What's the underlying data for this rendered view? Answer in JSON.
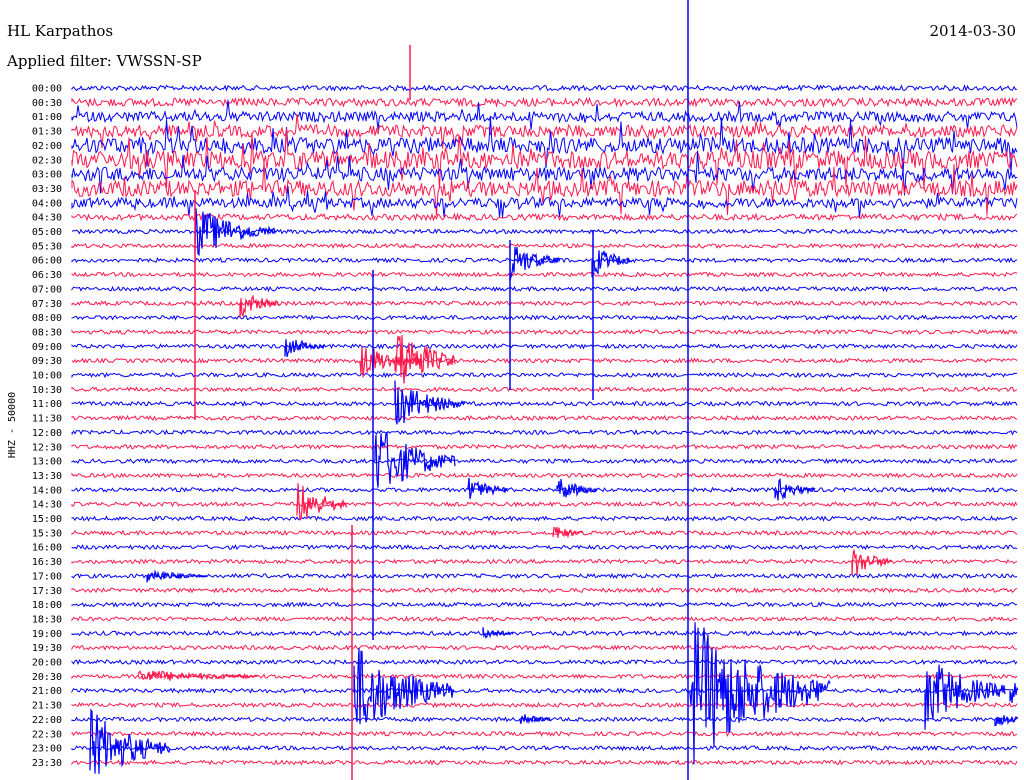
{
  "header": {
    "station": "HL Karpathos",
    "date": "2014-03-30",
    "filter": "Applied filter: VWSSN-SP"
  },
  "chart_data": {
    "type": "line",
    "title": "HL Karpathos",
    "ylabel": "HHZ - 50000",
    "colors": [
      "#0000ff",
      "#ff1a4d"
    ],
    "rows": [
      "00:00",
      "00:30",
      "01:00",
      "01:30",
      "02:00",
      "02:30",
      "03:00",
      "03:30",
      "04:00",
      "04:30",
      "05:00",
      "05:30",
      "06:00",
      "06:30",
      "07:00",
      "07:30",
      "08:00",
      "08:30",
      "09:00",
      "09:30",
      "10:00",
      "10:30",
      "11:00",
      "11:30",
      "12:00",
      "12:30",
      "13:00",
      "13:30",
      "14:00",
      "14:30",
      "15:00",
      "15:30",
      "16:00",
      "16:30",
      "17:00",
      "17:30",
      "18:00",
      "18:30",
      "19:00",
      "19:30",
      "20:00",
      "20:30",
      "21:00",
      "21:30",
      "22:00",
      "22:30",
      "23:00",
      "23:30"
    ],
    "noise_level": [
      2.5,
      4,
      5,
      6,
      8,
      9,
      7,
      8,
      5,
      3,
      2,
      2,
      2,
      2,
      2,
      2,
      2,
      2,
      2,
      2,
      2,
      2,
      2,
      2,
      2,
      2,
      2,
      2,
      2,
      2,
      2,
      2,
      2,
      2,
      2,
      2,
      2,
      2,
      2,
      2,
      2,
      2,
      2,
      2,
      2,
      2,
      2,
      2
    ]
  }
}
